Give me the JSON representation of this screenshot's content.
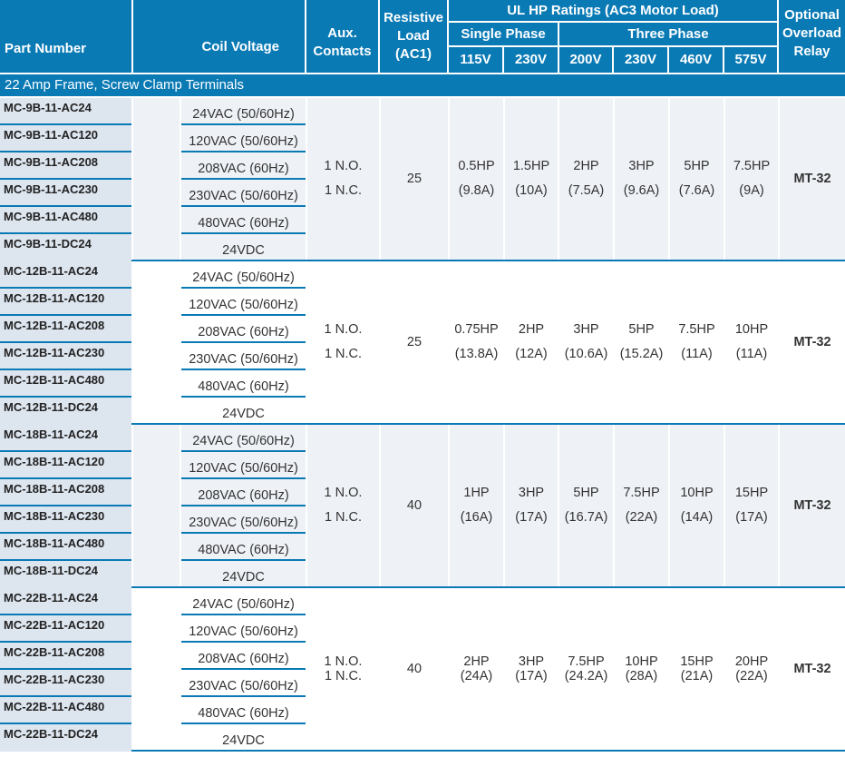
{
  "header": {
    "part_number": "Part Number",
    "coil_voltage": "Coil Voltage",
    "aux_contacts": "Aux. Contacts",
    "resistive_load": "Resistive Load (AC1)",
    "ul_hp_ratings": "UL HP Ratings (AC3 Motor Load)",
    "single_phase": "Single Phase",
    "three_phase": "Three Phase",
    "voltages": [
      "115V",
      "230V",
      "200V",
      "230V",
      "460V",
      "575V"
    ],
    "overload_relay": "Optional Overload Relay"
  },
  "section_title": "22 Amp Frame, Screw Clamp Terminals",
  "colors": {
    "header_blue": "#0a7ab5",
    "row_shade": "#eef1f6",
    "part_cell": "#dde5ef"
  },
  "groups": [
    {
      "parts": [
        "MC-9B-11-AC24",
        "MC-9B-11-AC120",
        "MC-9B-11-AC208",
        "MC-9B-11-AC230",
        "MC-9B-11-AC480",
        "MC-9B-11-DC24"
      ],
      "coils": [
        "24VAC (50/60Hz)",
        "120VAC (50/60Hz)",
        "208VAC (60Hz)",
        "230VAC (50/60Hz)",
        "480VAC (60Hz)",
        "24VDC"
      ],
      "aux": [
        "1 N.O.",
        "1 N.C."
      ],
      "resistive": "25",
      "ratings": [
        [
          "0.5HP",
          "(9.8A)"
        ],
        [
          "1.5HP",
          "(10A)"
        ],
        [
          "2HP",
          "(7.5A)"
        ],
        [
          "3HP",
          "(9.6A)"
        ],
        [
          "5HP",
          "(7.6A)"
        ],
        [
          "7.5HP",
          "(9A)"
        ]
      ],
      "relay": "MT-32"
    },
    {
      "parts": [
        "MC-12B-11-AC24",
        "MC-12B-11-AC120",
        "MC-12B-11-AC208",
        "MC-12B-11-AC230",
        "MC-12B-11-AC480",
        "MC-12B-11-DC24"
      ],
      "coils": [
        "24VAC (50/60Hz)",
        "120VAC (50/60Hz)",
        "208VAC (60Hz)",
        "230VAC (50/60Hz)",
        "480VAC (60Hz)",
        "24VDC"
      ],
      "aux": [
        "1 N.O.",
        "1 N.C."
      ],
      "resistive": "25",
      "ratings": [
        [
          "0.75HP",
          "(13.8A)"
        ],
        [
          "2HP",
          "(12A)"
        ],
        [
          "3HP",
          "(10.6A)"
        ],
        [
          "5HP",
          "(15.2A)"
        ],
        [
          "7.5HP",
          "(11A)"
        ],
        [
          "10HP",
          "(11A)"
        ]
      ],
      "relay": "MT-32"
    },
    {
      "parts": [
        "MC-18B-11-AC24",
        "MC-18B-11-AC120",
        "MC-18B-11-AC208",
        "MC-18B-11-AC230",
        "MC-18B-11-AC480",
        "MC-18B-11-DC24"
      ],
      "coils": [
        "24VAC (50/60Hz)",
        "120VAC (50/60Hz)",
        "208VAC (60Hz)",
        "230VAC (50/60Hz)",
        "480VAC (60Hz)",
        "24VDC"
      ],
      "aux": [
        "1 N.O.",
        "1 N.C."
      ],
      "resistive": "40",
      "ratings": [
        [
          "1HP",
          "(16A)"
        ],
        [
          "3HP",
          "(17A)"
        ],
        [
          "5HP",
          "(16.7A)"
        ],
        [
          "7.5HP",
          "(22A)"
        ],
        [
          "10HP",
          "(14A)"
        ],
        [
          "15HP",
          "(17A)"
        ]
      ],
      "relay": "MT-32"
    },
    {
      "parts": [
        "MC-22B-11-AC24",
        "MC-22B-11-AC120",
        "MC-22B-11-AC208",
        "MC-22B-11-AC230",
        "MC-22B-11-AC480",
        "MC-22B-11-DC24"
      ],
      "coils": [
        "24VAC (50/60Hz)",
        "120VAC (50/60Hz)",
        "208VAC (60Hz)",
        "230VAC (50/60Hz)",
        "480VAC (60Hz)",
        "24VDC"
      ],
      "aux": [
        "1 N.O.",
        "1 N.C."
      ],
      "resistive": "40",
      "ratings": [
        [
          "2HP",
          "(24A)"
        ],
        [
          "3HP",
          "(17A)"
        ],
        [
          "7.5HP",
          "(24.2A)"
        ],
        [
          "10HP",
          "(28A)"
        ],
        [
          "15HP",
          "(21A)"
        ],
        [
          "20HP",
          "(22A)"
        ]
      ],
      "relay": "MT-32"
    }
  ]
}
